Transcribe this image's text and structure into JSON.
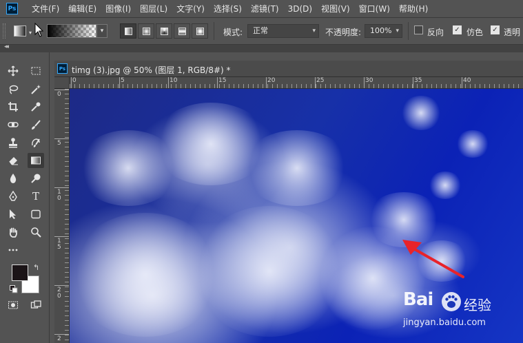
{
  "app": {
    "logo": "Ps",
    "menu": [
      "文件(F)",
      "编辑(E)",
      "图像(I)",
      "图层(L)",
      "文字(Y)",
      "选择(S)",
      "滤镜(T)",
      "3D(D)",
      "视图(V)",
      "窗口(W)",
      "帮助(H)"
    ]
  },
  "options": {
    "mode_label": "模式:",
    "mode_value": "正常",
    "opacity_label": "不透明度:",
    "opacity_value": "100%",
    "reverse_label": "反向",
    "reverse_checked": false,
    "dither_label": "仿色",
    "dither_checked": true,
    "transparency_label": "透明",
    "transparency_checked": true
  },
  "colors": {
    "foreground": "#1b1417",
    "background": "#ffffff"
  },
  "document": {
    "icon": "Ps",
    "title": "timg (3).jpg @ 50% (图层 1, RGB/8#) *"
  },
  "rulers": {
    "top_labels": [
      "0",
      "5",
      "10",
      "15",
      "20",
      "25",
      "30",
      "35",
      "40"
    ],
    "left_labels": [
      "0",
      "5",
      "1\n0",
      "1\n5",
      "2\n0",
      "2"
    ]
  },
  "watermark": {
    "brand": "Bai",
    "brand_suffix": "du",
    "cn": "经验",
    "url": "jingyan.baidu.com"
  }
}
